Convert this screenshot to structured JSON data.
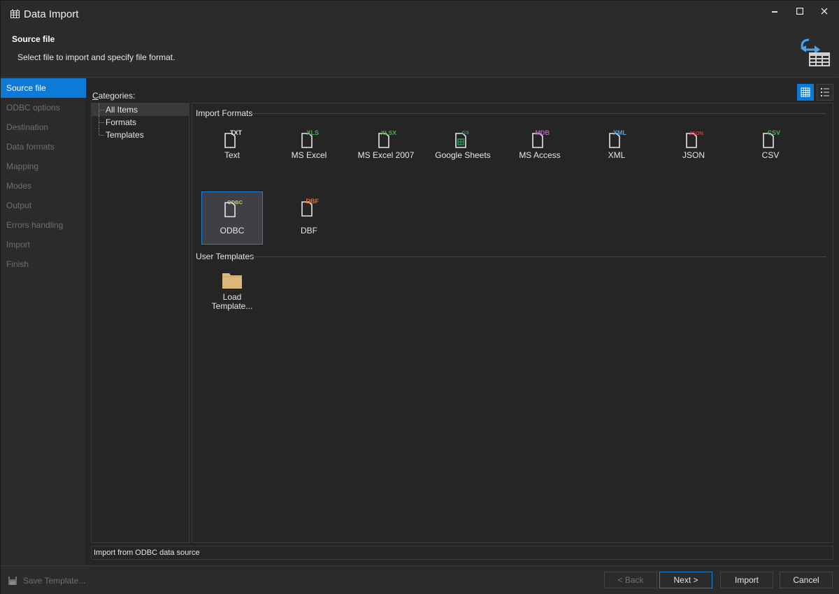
{
  "window": {
    "title": "Data Import",
    "controls": {
      "minimize": "▁",
      "maximize": "☐",
      "close": "✕"
    }
  },
  "header": {
    "title": "Source file",
    "subtitle": "Select file to import and specify file format."
  },
  "sidebar": {
    "items": [
      {
        "label": "Source file",
        "active": true
      },
      {
        "label": "ODBC options",
        "active": false
      },
      {
        "label": "Destination",
        "active": false
      },
      {
        "label": "Data formats",
        "active": false
      },
      {
        "label": "Mapping",
        "active": false
      },
      {
        "label": "Modes",
        "active": false
      },
      {
        "label": "Output",
        "active": false
      },
      {
        "label": "Errors handling",
        "active": false
      },
      {
        "label": "Import",
        "active": false
      },
      {
        "label": "Finish",
        "active": false
      }
    ]
  },
  "categories": {
    "label_access": "C",
    "label_rest": "ategories:",
    "items": [
      {
        "label": "All Items",
        "selected": true
      },
      {
        "label": "Formats",
        "selected": false
      },
      {
        "label": "Templates",
        "selected": false
      }
    ]
  },
  "import_formats": {
    "title": "Import Formats",
    "items": [
      {
        "label": "Text",
        "badge": "TXT",
        "badge_color": "#e6e6e6",
        "icon": "txt-file-icon"
      },
      {
        "label": "MS Excel",
        "badge": "XLS",
        "badge_color": "#4caf50",
        "icon": "xls-file-icon"
      },
      {
        "label": "MS Excel 2007",
        "badge": "XLSX",
        "badge_color": "#4caf50",
        "icon": "xlsx-file-icon"
      },
      {
        "label": "Google Sheets",
        "badge": "GS",
        "badge_color": "#2e9e5b",
        "icon": "google-sheets-file-icon"
      },
      {
        "label": "MS Access",
        "badge": "MDB",
        "badge_color": "#b05fb0",
        "icon": "mdb-file-icon"
      },
      {
        "label": "XML",
        "badge": "XML",
        "badge_color": "#4aa3e8",
        "icon": "xml-file-icon"
      },
      {
        "label": "JSON",
        "badge": "JSON",
        "badge_color": "#d9363e",
        "icon": "json-file-icon"
      },
      {
        "label": "CSV",
        "badge": "CSV",
        "badge_color": "#4caf50",
        "icon": "csv-file-icon"
      },
      {
        "label": "ODBC",
        "badge": "ODBC",
        "badge_color": "#c6d46a",
        "icon": "odbc-file-icon",
        "selected": true
      },
      {
        "label": "DBF",
        "badge": "DBF",
        "badge_color": "#e8702a",
        "icon": "dbf-file-icon"
      }
    ]
  },
  "user_templates": {
    "title": "User Templates",
    "items": [
      {
        "label_line1": "Load",
        "label_line2": "Template...",
        "icon": "folder-icon",
        "color": "#dcb67a"
      }
    ]
  },
  "status_text": "Import from ODBC data source",
  "footer": {
    "save_template": "Save Template...",
    "back": "< Back",
    "next": "Next >",
    "import": "Import",
    "cancel": "Cancel"
  },
  "colors": {
    "accent": "#0e7ad8",
    "background": "#2b2b2b",
    "panel": "#252526"
  }
}
